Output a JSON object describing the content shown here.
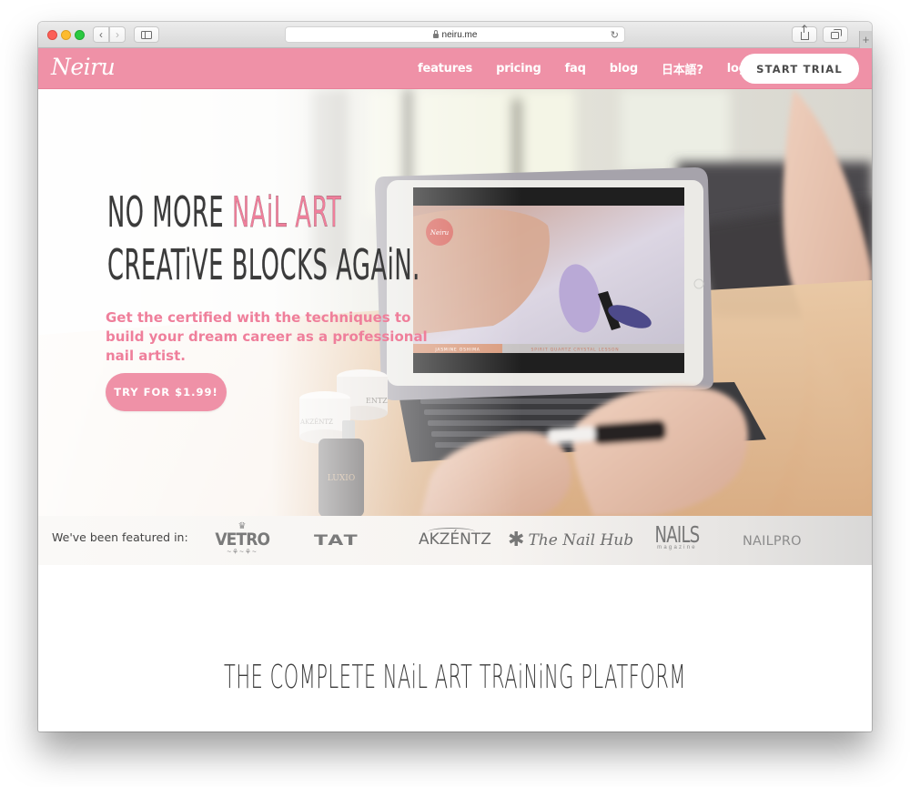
{
  "browser": {
    "url": "neiru.me",
    "back_glyph": "‹",
    "forward_glyph": "›",
    "reload_glyph": "↻",
    "new_tab_glyph": "+",
    "icons": [
      "close-window-icon",
      "minimize-window-icon",
      "zoom-window-icon",
      "back-icon",
      "forward-icon",
      "sidebar-icon",
      "lock-icon",
      "reload-icon",
      "share-icon",
      "tabs-overview-icon",
      "new-tab-icon"
    ]
  },
  "site": {
    "logo": "Neiru",
    "brand_color": "#ef91a7",
    "accent_text_color": "#ef7f9b",
    "nav": [
      {
        "label": "features"
      },
      {
        "label": "pricing"
      },
      {
        "label": "faq"
      },
      {
        "label": "blog"
      },
      {
        "label": "日本語?"
      },
      {
        "label": "login"
      }
    ],
    "cta_label": "START TRIAL"
  },
  "hero": {
    "headline_line1_plain": "NO MORE ",
    "headline_line1_accent": "NAiL ART",
    "headline_line2": "CREATiVE BLOCKS AGAiN.",
    "subhead": "Get the certified with the techniques to build your dream career as a professional nail artist.",
    "button_label": "TRY FOR $1.99!",
    "tablet_screen": {
      "badge": "Neiru",
      "caption_left": "JASMINE OSHIMA",
      "caption_right": "SPIRIT QUARTZ CRYSTAL LESSON"
    },
    "products": {
      "bottle_label": "LUXIO",
      "jar_label_1": "AKZÉNTZ",
      "jar_label_2": "ENTZ"
    }
  },
  "featured": {
    "label": "We've been featured in:",
    "brands": {
      "vetro": {
        "name": "VETRO",
        "crown": "♛",
        "flourish": "~⚘~⚘~"
      },
      "tat": {
        "name": "TAT"
      },
      "akzentz": {
        "name": "AKZÉNTZ"
      },
      "nailhub": {
        "star": "✱",
        "name": "The Nail Hub"
      },
      "nails": {
        "name": "NAILS",
        "sub": "magazine"
      },
      "nailpro": {
        "name": "NAILPRO"
      }
    }
  },
  "section": {
    "title": "THE COMPLETE NAiL ART TRAiNiNG PLATFORM"
  }
}
